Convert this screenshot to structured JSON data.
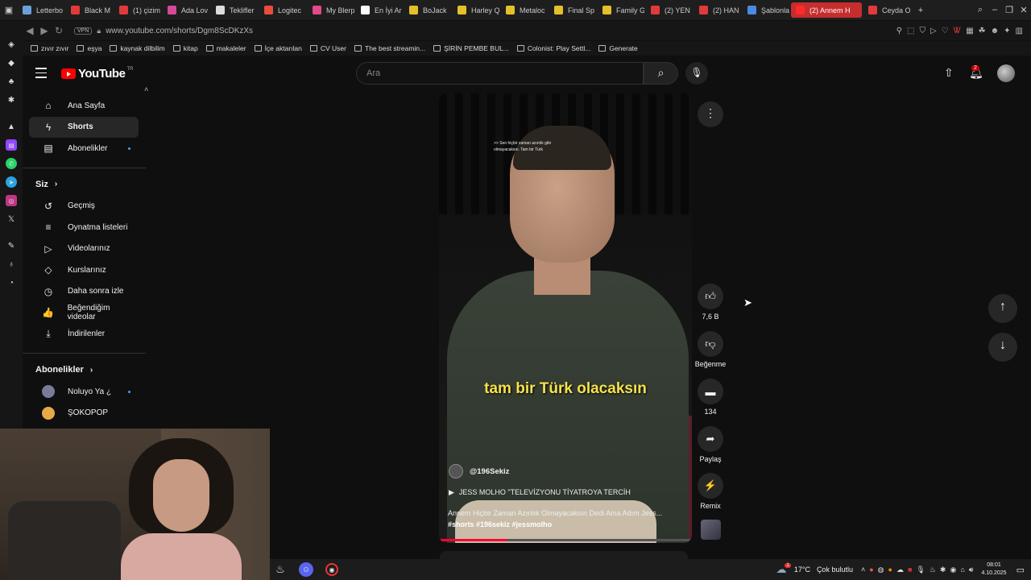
{
  "browser": {
    "tabs": [
      {
        "label": "Letterbo",
        "color": "#6aa0d8"
      },
      {
        "label": "Black M",
        "color": "#e23a3a"
      },
      {
        "label": "(1) çizim",
        "color": "#e23a3a"
      },
      {
        "label": "Ada Lov",
        "color": "#d44a9a"
      },
      {
        "label": "Teklifler",
        "color": "#dddddd"
      },
      {
        "label": "Logitec",
        "color": "#e94c3d"
      },
      {
        "label": "My Blerp",
        "color": "#e24a8a"
      },
      {
        "label": "En İyi Ar",
        "color": "#ffffff"
      },
      {
        "label": "BoJack",
        "color": "#e5c02a"
      },
      {
        "label": "Harley Q",
        "color": "#e5c02a"
      },
      {
        "label": "Metaloc",
        "color": "#e5c02a"
      },
      {
        "label": "Final Sp",
        "color": "#e5c02a"
      },
      {
        "label": "Family G",
        "color": "#e5c02a"
      },
      {
        "label": "(2) YEN",
        "color": "#e23a3a"
      },
      {
        "label": "(2) HAN",
        "color": "#e23a3a"
      },
      {
        "label": "Şablonla",
        "color": "#4a8ae2"
      },
      {
        "label": "(2) Annem H",
        "color": "#ff2a2a",
        "active": true
      },
      {
        "label": "Ceyda O",
        "color": "#e23a3a"
      }
    ],
    "url": "www.youtube.com/shorts/Dgm8ScDKzXs",
    "vpn_label": "VPN",
    "bookmarks": [
      "zıvır zıvır",
      "eşya",
      "kaynak dilbilim",
      "kitap",
      "makaleler",
      "İçe aktarılan",
      "CV User",
      "The best streamin...",
      "ŞİRİN PEMBE BUL...",
      "Colonist: Play Settl...",
      "Generate"
    ]
  },
  "youtube": {
    "logo_text": "YouTube",
    "region": "TR",
    "search_placeholder": "Ara",
    "notification_count": "2"
  },
  "sidebar": {
    "main": [
      {
        "label": "Ana Sayfa",
        "icon": "home-icon",
        "glyph": "⌂"
      },
      {
        "label": "Shorts",
        "icon": "shorts-icon",
        "glyph": "ϟ",
        "selected": true
      },
      {
        "label": "Abonelikler",
        "icon": "subscriptions-icon",
        "glyph": "▤",
        "dot": true
      }
    ],
    "you_heading": "Siz",
    "you": [
      {
        "label": "Geçmiş",
        "icon": "history-icon",
        "glyph": "↺"
      },
      {
        "label": "Oynatma listeleri",
        "icon": "playlists-icon",
        "glyph": "≡"
      },
      {
        "label": "Videolarınız",
        "icon": "your-videos-icon",
        "glyph": "▷"
      },
      {
        "label": "Kurslarınız",
        "icon": "courses-icon",
        "glyph": "◇"
      },
      {
        "label": "Daha sonra izle",
        "icon": "watch-later-icon",
        "glyph": "◷"
      },
      {
        "label": "Beğendiğim videolar",
        "icon": "liked-videos-icon",
        "glyph": "👍"
      },
      {
        "label": "İndirilenler",
        "icon": "downloads-icon",
        "glyph": "⤓"
      }
    ],
    "subs_heading": "Abonelikler",
    "subs": [
      {
        "label": "Noluyo Ya ¿",
        "color": "#7a7a9a",
        "dot": true
      },
      {
        "label": "ŞOKOPOP",
        "color": "#e7a94a"
      }
    ]
  },
  "short": {
    "quote_overlay": ">> Sen hiçbir zaman azınlık gibi olmayacaksın. Tam bir Türk",
    "subtitle": "tam bir Türk olacaksın",
    "channel": "@196Sekiz",
    "music": "JESS MOLHO \"TELEVİZYONU TİYATROYA TERCİH",
    "title": "Annem Hiçbir Zaman Azınlık Olmayacaksın Dedi Ama Adım Jess...",
    "hashtags": "#shorts #196sekiz #jessmolho",
    "progress_fraction": 0.27
  },
  "actions": {
    "like_count": "7,6 B",
    "dislike_label": "Beğenme",
    "comment_count": "134",
    "share_label": "Paylaş",
    "remix_label": "Remix"
  },
  "taskbar": {
    "temperature": "17°C",
    "weather": "Çok bulutlu",
    "weather_badge": "1",
    "time": "08:01",
    "date": "4.10.2025"
  }
}
